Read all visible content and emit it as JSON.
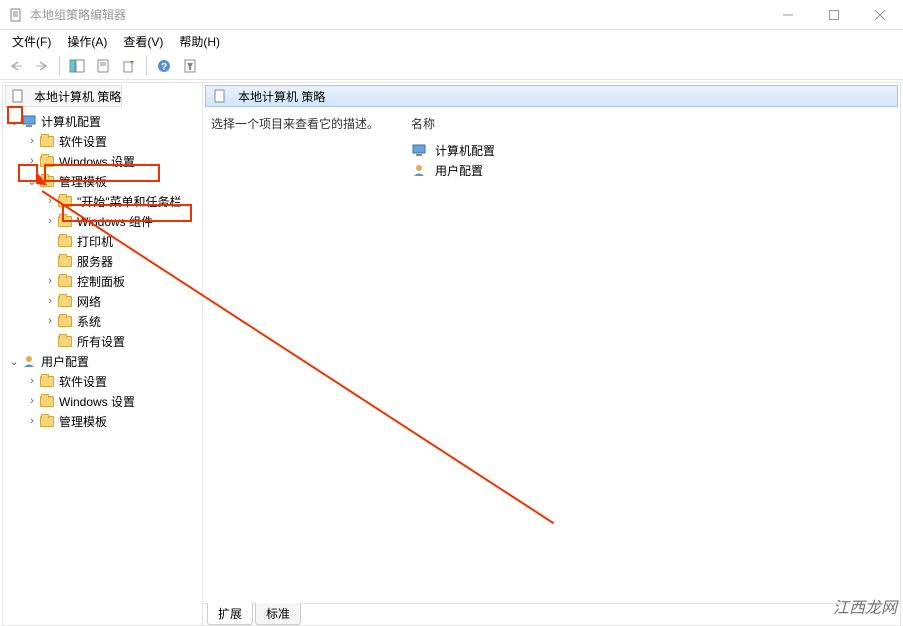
{
  "window": {
    "title": "本地组策略编辑器"
  },
  "menu": {
    "file": "文件(F)",
    "action": "操作(A)",
    "view": "查看(V)",
    "help": "帮助(H)"
  },
  "tree": {
    "root": "本地计算机 策略",
    "computer": "计算机配置",
    "nodes": {
      "sw_settings": "软件设置",
      "win_settings": "Windows 设置",
      "admin_tmpl": "管理模板",
      "start_taskbar": "\"开始\"菜单和任务栏",
      "win_components": "Windows 组件",
      "printers": "打印机",
      "servers": "服务器",
      "control_panel": "控制面板",
      "network": "网络",
      "system": "系统",
      "all_settings": "所有设置"
    },
    "user": "用户配置",
    "user_nodes": {
      "sw_settings": "软件设置",
      "win_settings": "Windows 设置",
      "admin_tmpl": "管理模板"
    }
  },
  "right": {
    "header": "本地计算机 策略",
    "desc": "选择一个项目来查看它的描述。",
    "col_name": "名称",
    "items": {
      "computer": "计算机配置",
      "user": "用户配置"
    },
    "tabs": {
      "extended": "扩展",
      "standard": "标准"
    }
  },
  "watermark": "江西龙网"
}
